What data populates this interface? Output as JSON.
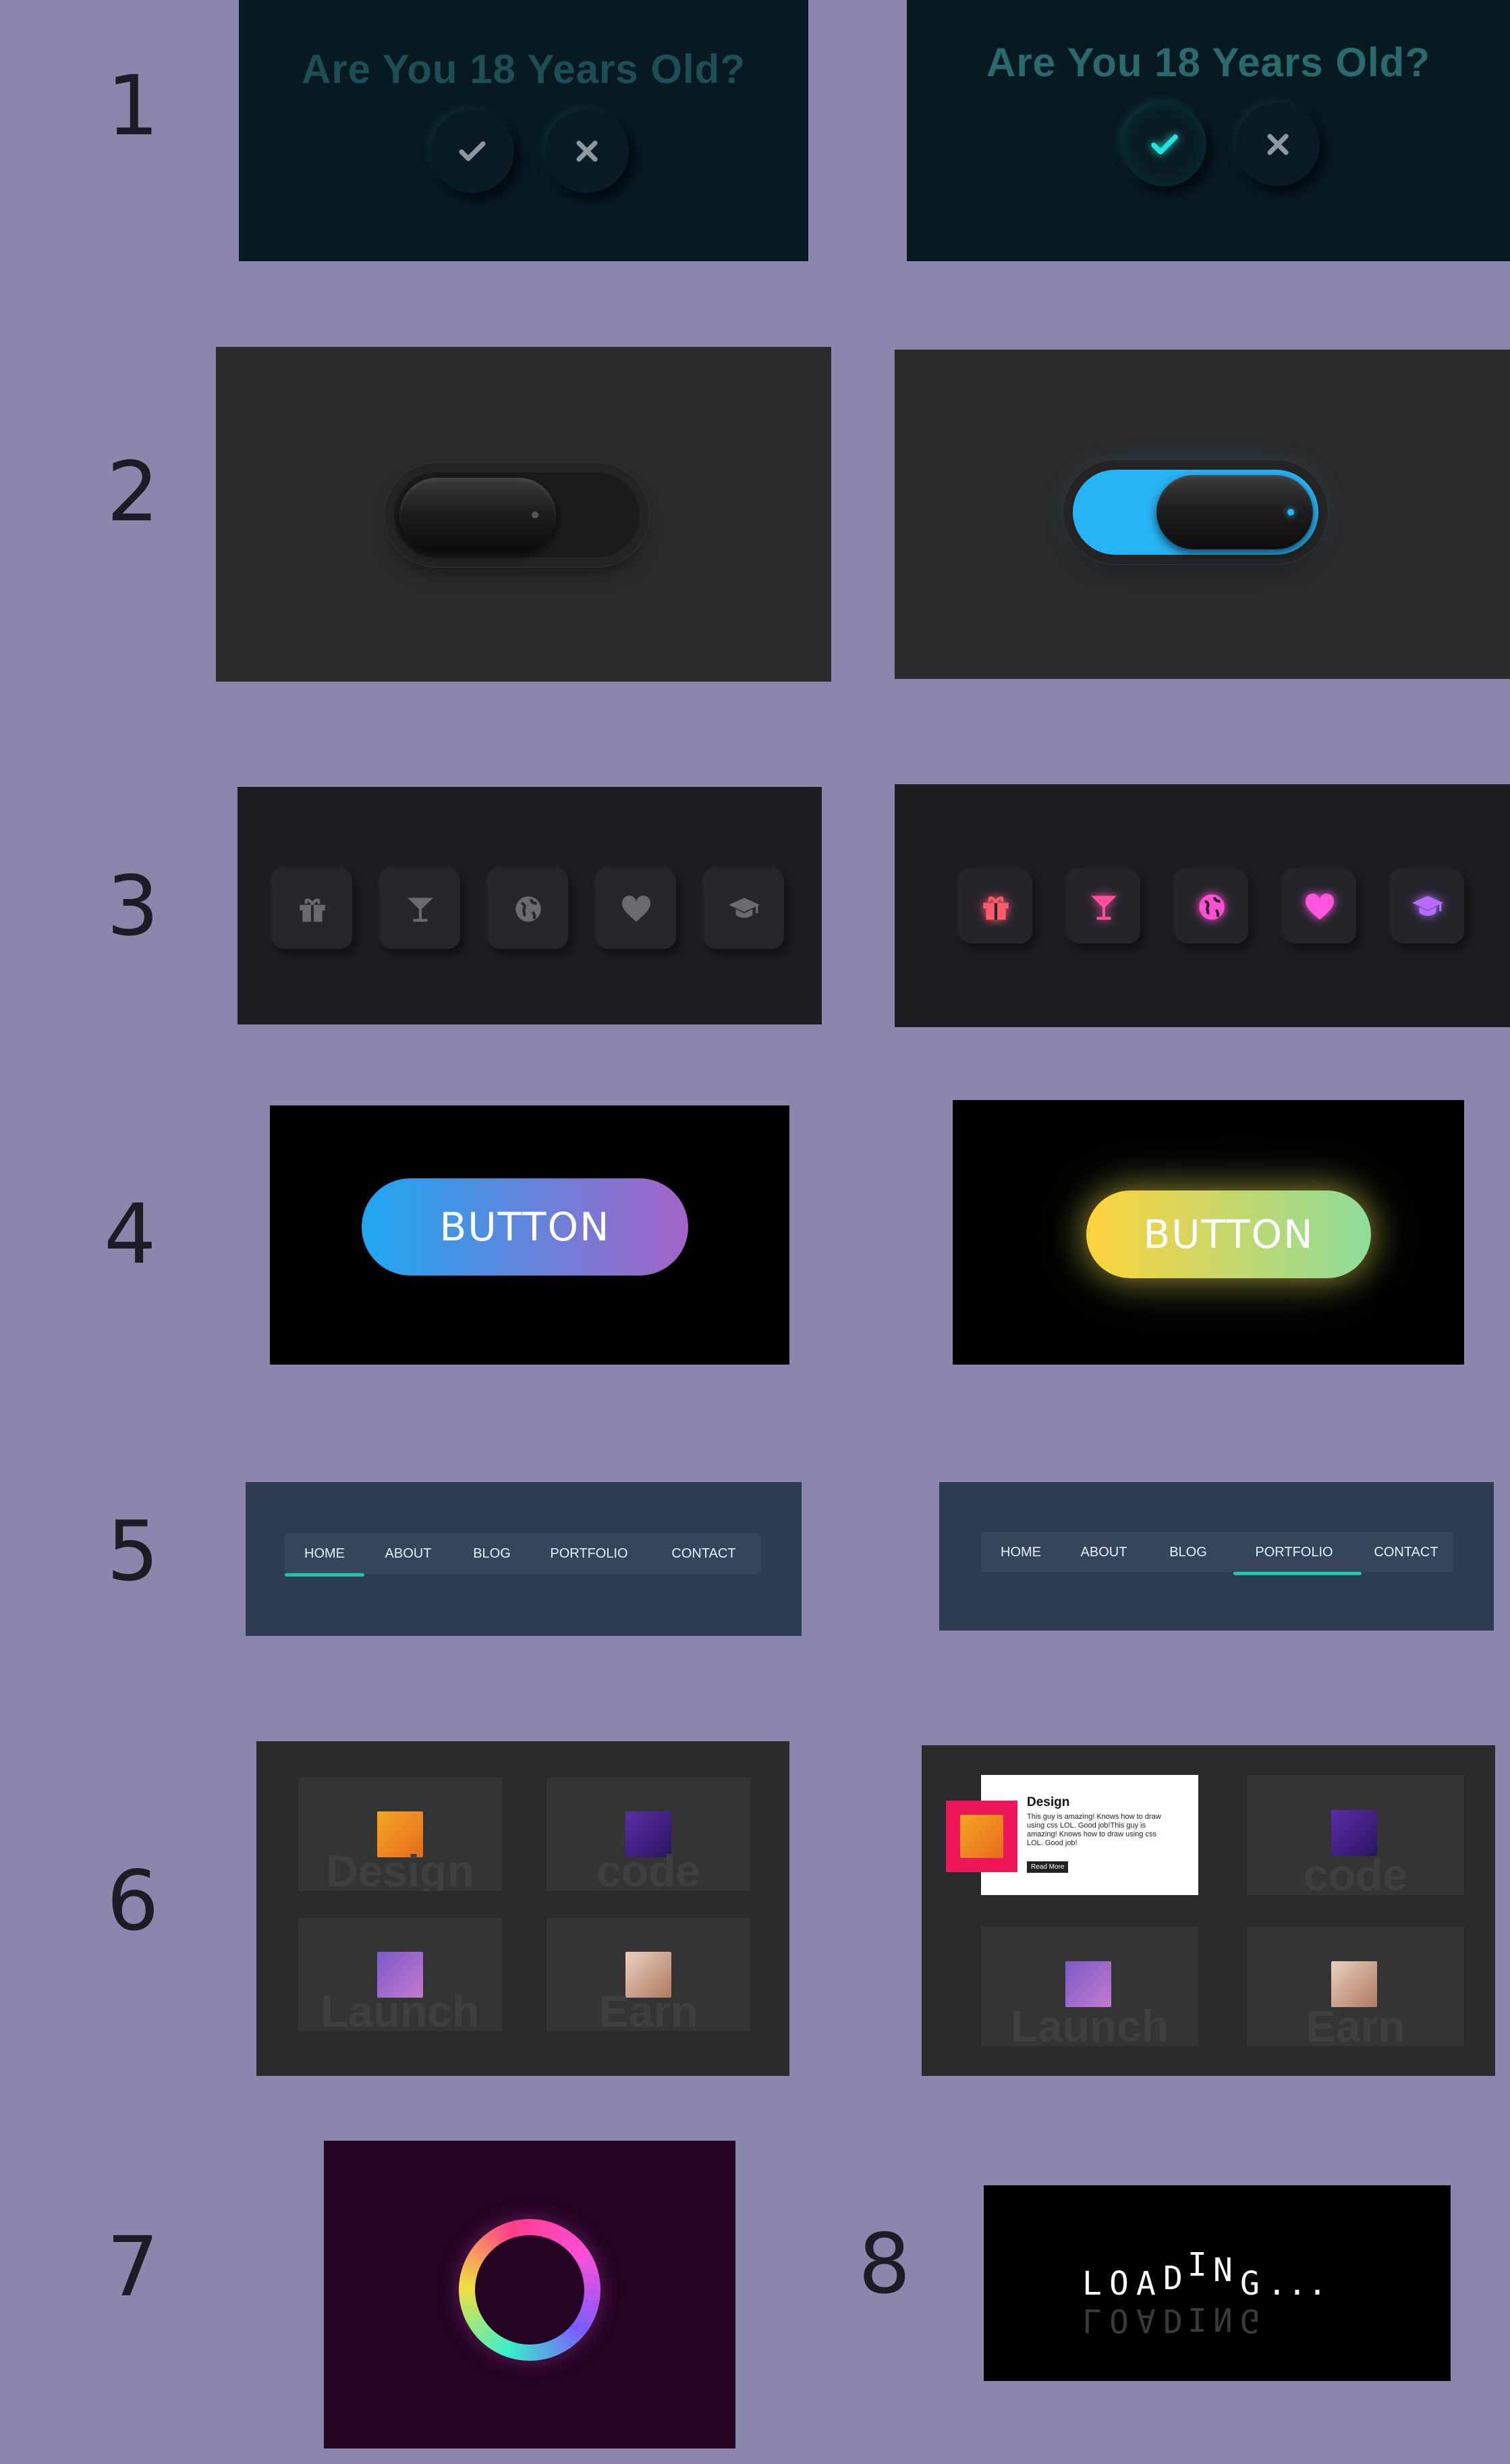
{
  "numbers": [
    "1",
    "2",
    "3",
    "4",
    "5",
    "6",
    "7",
    "8"
  ],
  "age_prompt": {
    "question": "Are You 18 Years Old?",
    "yes_icon": "check-icon",
    "no_icon": "x-icon",
    "colors": {
      "bg": "#071a22",
      "active_check": "#27e3e0"
    }
  },
  "toggle": {
    "on_color": "#27b4f5",
    "led_on": "#27b4f5"
  },
  "icons": {
    "names": [
      "gift-icon",
      "cocktail-icon",
      "globe-icon",
      "heart-icon",
      "graduation-cap-icon"
    ],
    "glow_colors": [
      "#ff5a6e",
      "#ff4fa0",
      "#ff4fd0",
      "#ff55e0",
      "#b66cff"
    ]
  },
  "gradient_button": {
    "label": "BUTTON",
    "colors_default": [
      "#1ea7f0",
      "#a463c8"
    ],
    "colors_hover": [
      "#ffd23a",
      "#8edc9c"
    ]
  },
  "nav": {
    "items": [
      "HOME",
      "ABOUT",
      "BLOG",
      "PORTFOLIO",
      "CONTACT"
    ],
    "accent": "#1cc8a5"
  },
  "cards": {
    "titles": [
      "Design",
      "code",
      "Launch",
      "Earn"
    ],
    "popup": {
      "title": "Design",
      "body_lines": [
        "This guy is amazing! Knows how to draw",
        "using css LOL. Good job!This guy is",
        "amazing! Knows how to draw using css",
        "LOL. Good job!"
      ],
      "button": "Read More",
      "accent": "#ee1558"
    }
  },
  "loading": {
    "letters": [
      "L",
      "O",
      "A",
      "D",
      "I",
      "N",
      "G",
      ".",
      ".",
      "."
    ]
  }
}
